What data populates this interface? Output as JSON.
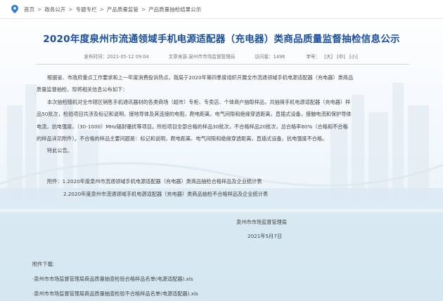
{
  "breadcrumb": {
    "items": [
      "首页",
      "政务公开",
      "专题专栏",
      "产品质量监管",
      "产品质量抽检结果公示"
    ],
    "separator": ">"
  },
  "article": {
    "title": "2020年度泉州市流通领域手机电源适配器（充电器）类商品质量监督抽检信息公示",
    "meta": {
      "publish_time": "发布时间：2021-05-12 09:04",
      "source": "文章来源:泉州市市场监督管理局",
      "views": "访问量：1496",
      "font_label": "字号：",
      "size_large": "[大]",
      "size_medium": "[中]",
      "size_small": "[小]"
    },
    "para1_line1": "根据省、市政府重点工作要求和上一年度消费投诉热点，我局于2020年第四季度组织开展全市流通领域手机电源适配器（充电器）类商品",
    "para1_line2": "质量监督抽检，现将相关信息公布如下：",
    "para2_line1": "本次抽检随机对全市辖区销售手机通讯器材的各类商场（超市）专柜、专卖店、个体商户抽取样品，共抽得手机电源适配器（充电器）样",
    "para2_line2": "品50批次，检验项目共涉及标记和说明，接地导体及其连接的电阻，爬电距离、电气间隙和绝缘穿透距离，直插式设备，接触电流和保护导体",
    "para2_line3": "电流，抗电强度，（30-1000）MHz辐射骚扰等项目。所检项目全部合格的样品30批次，不合格样品20批次，总合格率60%（合格和不合格",
    "para2_line4": "的样品详见附件）。不合格的样品主要问题是：标记和说明，爬电距离、电气间隙和绝缘穿透距离，直插式设备，抗电强度不合格。",
    "para3": "特此公告。",
    "attachment1": "附件：1.2020年度泉州市流通领域手机电源适配器（充电器）类商品抽检合格样品及企业统计表",
    "attachment2": "2.2020年度泉州市流通领域手机电源适配器（充电器）类商品抽检不合格样品及企业统计表",
    "issuer": "泉州市市场监督管理局",
    "date": "2021年5月7日"
  },
  "downloads": {
    "heading": "附件下载:",
    "files": [
      "·泉州市市场监督管理局商品质量抽查检验合格样品名单(电源适配器).xls",
      "·泉州市市场监督管理局商品质量抽查检验不合格样品名单(电源适配器).xls"
    ]
  },
  "colors": {
    "title": "#1b4f9c",
    "pin": "#2f7bd8",
    "text": "#444444"
  }
}
